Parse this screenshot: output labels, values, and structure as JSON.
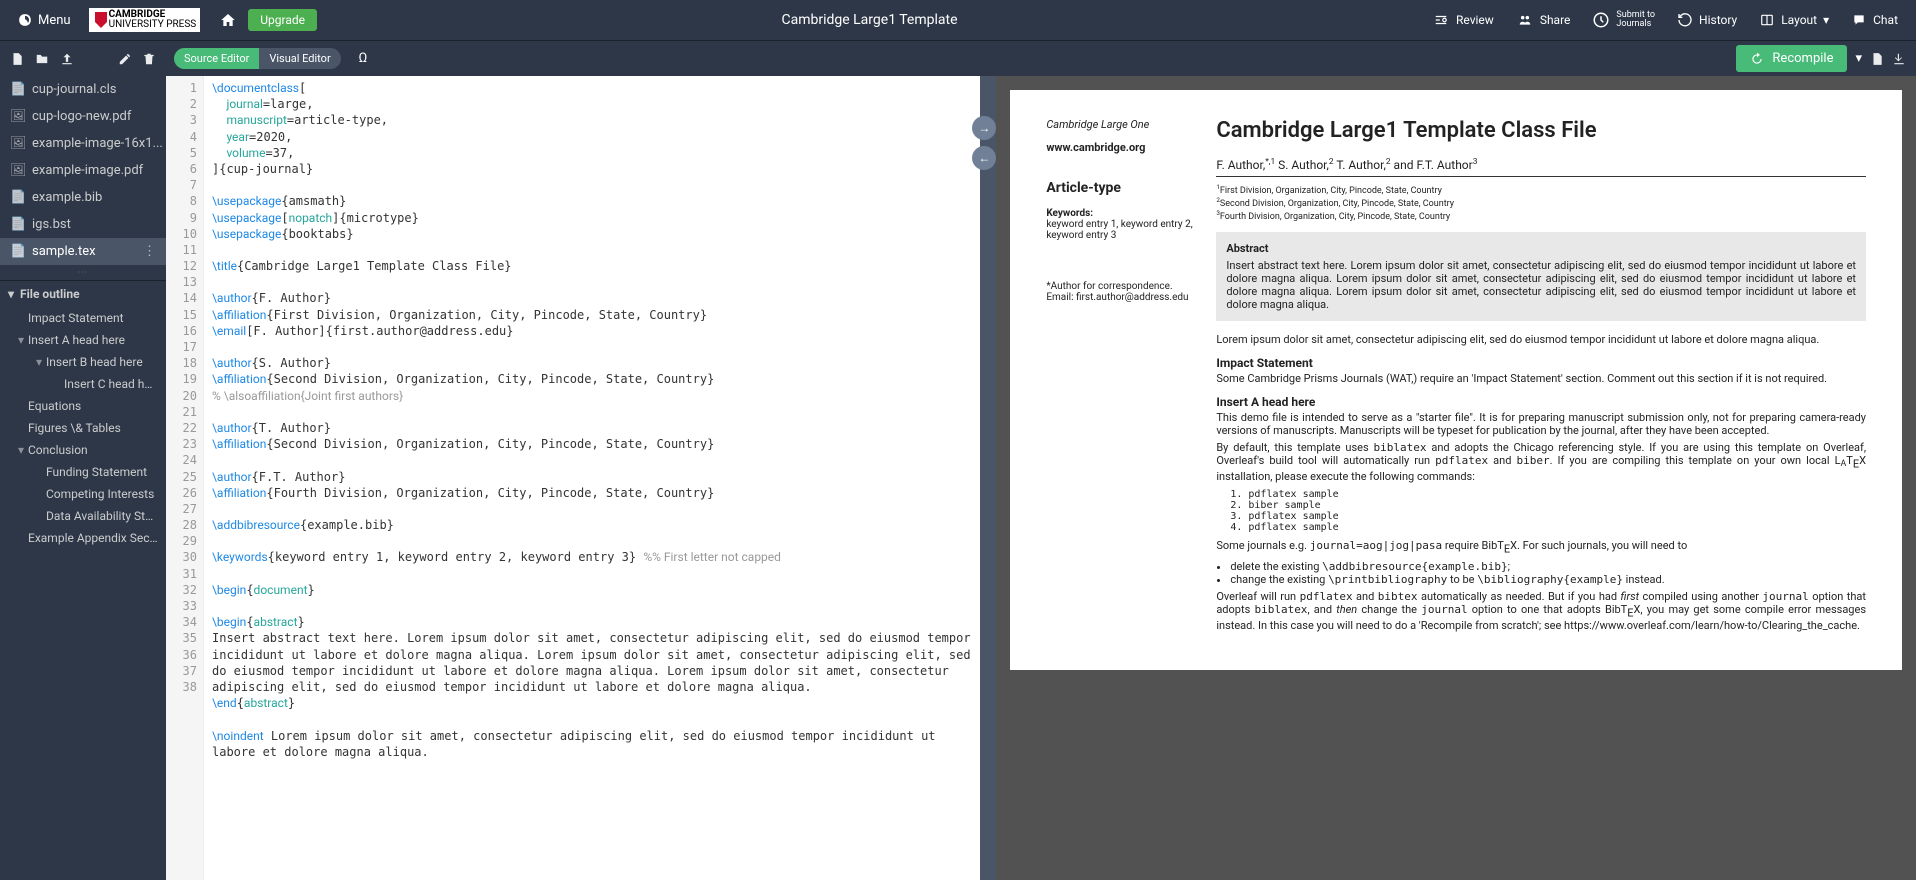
{
  "topbar": {
    "menu": "Menu",
    "logo_top": "CAMBRIDGE",
    "logo_bottom": "UNIVERSITY PRESS",
    "upgrade": "Upgrade",
    "title": "Cambridge Large1 Template",
    "review": "Review",
    "share": "Share",
    "submit_top": "Submit to",
    "submit_bottom": "Journals",
    "history": "History",
    "layout": "Layout",
    "chat": "Chat"
  },
  "toolbar": {
    "source_editor": "Source Editor",
    "visual_editor": "Visual Editor",
    "recompile": "Recompile"
  },
  "files": [
    {
      "icon": "file",
      "name": "cup-journal.cls"
    },
    {
      "icon": "image",
      "name": "cup-logo-new.pdf"
    },
    {
      "icon": "image",
      "name": "example-image-16x1..."
    },
    {
      "icon": "image",
      "name": "example-image.pdf"
    },
    {
      "icon": "file",
      "name": "example.bib"
    },
    {
      "icon": "file",
      "name": "igs.bst"
    },
    {
      "icon": "file",
      "name": "sample.tex",
      "active": true
    }
  ],
  "outline": {
    "header": "File outline",
    "items": [
      {
        "level": 1,
        "caret": false,
        "label": "Impact Statement"
      },
      {
        "level": 1,
        "caret": true,
        "label": "Insert A head here"
      },
      {
        "level": 2,
        "caret": true,
        "label": "Insert B head here"
      },
      {
        "level": 3,
        "caret": false,
        "label": "Insert C head here"
      },
      {
        "level": 1,
        "caret": false,
        "label": "Equations"
      },
      {
        "level": 1,
        "caret": false,
        "label": "Figures \\& Tables"
      },
      {
        "level": 1,
        "caret": true,
        "label": "Conclusion"
      },
      {
        "level": 2,
        "caret": false,
        "label": "Funding Statement"
      },
      {
        "level": 2,
        "caret": false,
        "label": "Competing Interests"
      },
      {
        "level": 2,
        "caret": false,
        "label": "Data Availability Stat..."
      },
      {
        "level": 1,
        "caret": false,
        "label": "Example Appendix Section"
      }
    ]
  },
  "code_lines": [
    {
      "n": 1,
      "html": "<span class='cmd'>\\documentclass</span>["
    },
    {
      "n": 2,
      "html": "  <span class='arg'>journal</span>=large,"
    },
    {
      "n": 3,
      "html": "  <span class='arg'>manuscript</span>=article-type,"
    },
    {
      "n": 4,
      "html": "  <span class='arg'>year</span>=2020,"
    },
    {
      "n": 5,
      "html": "  <span class='arg'>volume</span>=37,"
    },
    {
      "n": 6,
      "html": "]{cup-journal}"
    },
    {
      "n": 7,
      "html": ""
    },
    {
      "n": 8,
      "html": "<span class='cmd'>\\usepackage</span>{amsmath}"
    },
    {
      "n": 9,
      "html": "<span class='cmd'>\\usepackage</span>[<span class='arg'>nopatch</span>]{microtype}"
    },
    {
      "n": 10,
      "html": "<span class='cmd'>\\usepackage</span>{booktabs}"
    },
    {
      "n": 11,
      "html": ""
    },
    {
      "n": 12,
      "html": "<span class='cmd'>\\title</span>{Cambridge Large1 Template Class File}"
    },
    {
      "n": 13,
      "html": ""
    },
    {
      "n": 14,
      "html": "<span class='cmd'>\\author</span>{F. Author}"
    },
    {
      "n": 15,
      "html": "<span class='cmd'>\\affiliation</span>{First Division, Organization, City, Pincode, State, Country}"
    },
    {
      "n": 16,
      "html": "<span class='cmd'>\\email</span>[F. Author]{first.author@address.edu}"
    },
    {
      "n": 17,
      "html": ""
    },
    {
      "n": 18,
      "html": "<span class='cmd'>\\author</span>{S. Author}"
    },
    {
      "n": 19,
      "html": "<span class='cmd'>\\affiliation</span>{Second Division, Organization, City, Pincode, State, Country}"
    },
    {
      "n": 20,
      "html": "<span class='comment'>% \\alsoaffiliation{Joint first authors}</span>"
    },
    {
      "n": 21,
      "html": ""
    },
    {
      "n": 22,
      "html": "<span class='cmd'>\\author</span>{T. Author}"
    },
    {
      "n": 23,
      "html": "<span class='cmd'>\\affiliation</span>{Second Division, Organization, City, Pincode, State, Country}"
    },
    {
      "n": 24,
      "html": ""
    },
    {
      "n": 25,
      "html": "<span class='cmd'>\\author</span>{F.T. Author}"
    },
    {
      "n": 26,
      "html": "<span class='cmd'>\\affiliation</span>{Fourth Division, Organization, City, Pincode, State, Country}"
    },
    {
      "n": 27,
      "html": ""
    },
    {
      "n": 28,
      "html": "<span class='cmd'>\\addbibresource</span>{example.bib}"
    },
    {
      "n": 29,
      "html": ""
    },
    {
      "n": 30,
      "html": "<span class='cmd'>\\keywords</span>{keyword entry 1, keyword entry 2, keyword entry 3} <span class='comment'>%% First letter not capped</span>"
    },
    {
      "n": 31,
      "html": ""
    },
    {
      "n": 32,
      "html": "<span class='cmd'>\\begin</span>{<span class='arg'>document</span>}"
    },
    {
      "n": 33,
      "html": ""
    },
    {
      "n": 34,
      "html": "<span class='cmd'>\\begin</span>{<span class='arg'>abstract</span>}"
    },
    {
      "n": 35,
      "html": "Insert abstract text here. Lorem ipsum dolor sit amet, consectetur adipiscing elit, sed do eiusmod tempor incididunt ut labore et dolore magna aliqua. Lorem ipsum dolor sit amet, consectetur adipiscing elit, sed do eiusmod tempor incididunt ut labore et dolore magna aliqua. Lorem ipsum dolor sit amet, consectetur adipiscing elit, sed do eiusmod tempor incididunt ut labore et dolore magna aliqua."
    },
    {
      "n": 36,
      "html": "<span class='cmd'>\\end</span>{<span class='arg'>abstract</span>}"
    },
    {
      "n": 37,
      "html": ""
    },
    {
      "n": 38,
      "html": "<span class='cmd'>\\noindent</span> Lorem ipsum dolor sit amet, consectetur adipiscing elit, sed do eiusmod tempor incididunt ut labore et dolore magna aliqua."
    }
  ],
  "pdf": {
    "journal": "Cambridge Large One",
    "website": "www.cambridge.org",
    "article_type": "Article-type",
    "kw_label": "Keywords:",
    "keywords": "keyword entry 1, keyword entry 2, keyword entry 3",
    "corr": "*Author for correspondence. Email: first.author@address.edu",
    "title": "Cambridge Large1 Template Class File",
    "authors_html": "F. Author,<sup>*,1</sup> S. Author,<sup>2</sup> T. Author,<sup>2</sup> and F.T. Author<sup>3</sup>",
    "affiliations": [
      "1First Division, Organization, City, Pincode, State, Country",
      "2Second Division, Organization, City, Pincode, State, Country",
      "3Fourth Division, Organization, City, Pincode, State, Country"
    ],
    "abstract_h": "Abstract",
    "abstract": "Insert abstract text here. Lorem ipsum dolor sit amet, consectetur adipiscing elit, sed do eiusmod tempor incididunt ut labore et dolore magna aliqua. Lorem ipsum dolor sit amet, consectetur adipiscing elit, sed do eiusmod tempor incididunt ut labore et dolore magna aliqua. Lorem ipsum dolor sit amet, consectetur adipiscing elit, sed do eiusmod tempor incididunt ut labore et dolore magna aliqua.",
    "intro": "Lorem ipsum dolor sit amet, consectetur adipiscing elit, sed do eiusmod tempor incididunt ut labore et dolore magna aliqua.",
    "impact_h": "Impact Statement",
    "impact": "Some Cambridge Prisms Journals (WAT,) require an 'Impact Statement' section. Comment out this section if it is not required.",
    "ahead_h": "Insert A head here",
    "ahead_p1": "This demo file is intended to serve as a \"starter file\". It is for preparing manuscript submission only, not for preparing camera-ready versions of manuscripts. Manuscripts will be typeset for publication by the journal, after they have been accepted.",
    "ahead_p2_html": "By default, this template uses <span class='mono'>biblatex</span> and adopts the Chicago referencing style. If you are using this template on Overleaf, Overleaf's build tool will automatically run <span class='mono'>pdflatex</span> and <span class='mono'>biber</span>. If you are compiling this template on your own local L<span style='font-size:.8em;vertical-align:-.2em'>A</span>T<span style='vertical-align:-.3em'>E</span>X installation, please execute the following commands:",
    "commands": [
      "1. pdflatex sample",
      "2. biber sample",
      "3. pdflatex sample",
      "4. pdflatex sample"
    ],
    "journals_html": "Some journals e.g. <span class='mono'>journal=aog|jog|pasa</span> require BibT<span style='vertical-align:-.3em'>E</span>X. For such journals, you will need to",
    "bullets_html": [
      "delete the existing <span class='mono'>\\addbibresource{example.bib}</span>;",
      "change the existing <span class='mono'>\\printbibliography</span> to be <span class='mono'>\\bibliography{example}</span> instead."
    ],
    "overleaf_html": "Overleaf will run <span class='mono'>pdflatex</span> and <span class='mono'>bibtex</span> automatically as needed. But if you had <i>first</i> compiled using another <span class='mono'>journal</span> option that adopts <span class='mono'>biblatex</span>, and <i>then</i> change the <span class='mono'>journal</span> option to one that adopts BibT<span style='vertical-align:-.3em'>E</span>X, you may get some compile error messages instead. In this case you will need to do a 'Recompile from scratch'; see https://www.overleaf.com/learn/how-to/Clearing_the_cache."
  }
}
